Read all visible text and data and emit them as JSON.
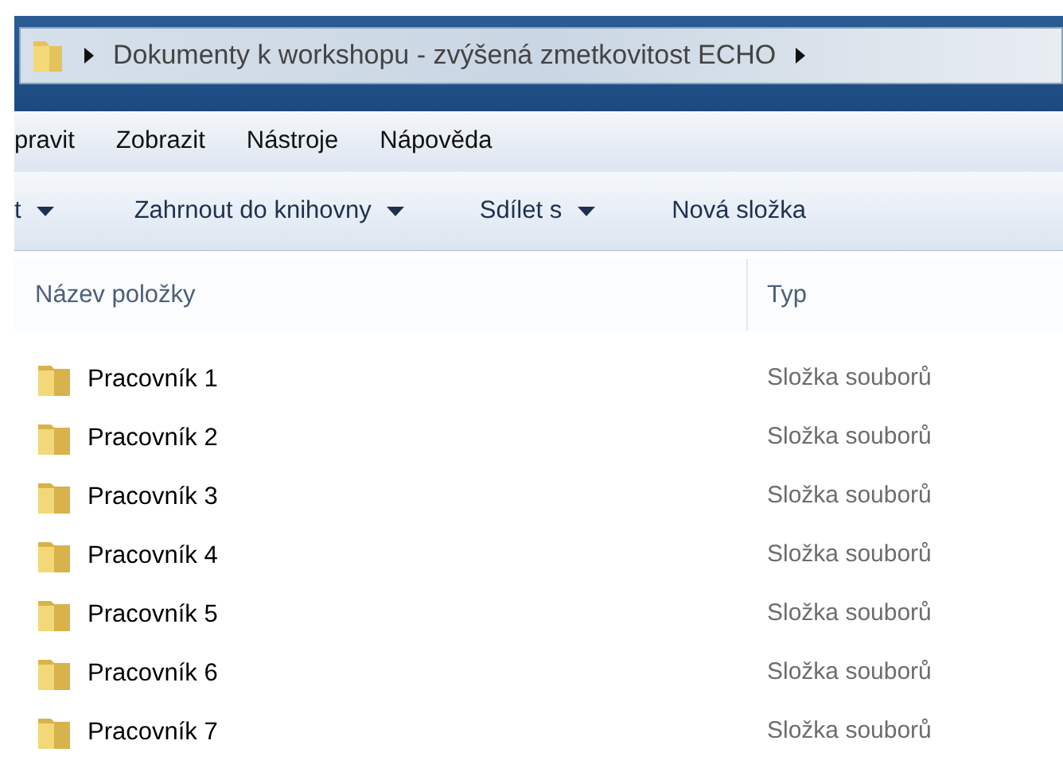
{
  "address_bar": {
    "path": "Dokumenty k workshopu - zvýšená zmetkovitost ECHO"
  },
  "menu_bar": [
    "pravit",
    "Zobrazit",
    "Nástroje",
    "Nápověda"
  ],
  "toolbar": [
    {
      "label": "t",
      "dropdown": true
    },
    {
      "label": "Zahrnout do knihovny",
      "dropdown": true
    },
    {
      "label": "Sdílet s",
      "dropdown": true
    },
    {
      "label": "Nová složka",
      "dropdown": false
    }
  ],
  "table": {
    "columns": [
      "Název položky",
      "Typ"
    ],
    "rows": [
      {
        "name": "Pracovník 1",
        "type": "Složka souborů"
      },
      {
        "name": "Pracovník 2",
        "type": "Složka souborů"
      },
      {
        "name": "Pracovník 3",
        "type": "Složka souborů"
      },
      {
        "name": "Pracovník 4",
        "type": "Složka souborů"
      },
      {
        "name": "Pracovník 5",
        "type": "Složka souborů"
      },
      {
        "name": "Pracovník 6",
        "type": "Složka souborů"
      },
      {
        "name": "Pracovník 7",
        "type": "Složka souborů"
      }
    ]
  }
}
